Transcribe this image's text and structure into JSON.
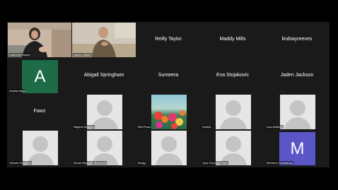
{
  "participants": {
    "p01": {
      "name": "Katherine Boyce"
    },
    "p02": {
      "name": "James Gilbert"
    },
    "p03": {
      "name": "Reilly Taylor"
    },
    "p04": {
      "name": "Maddy Mills"
    },
    "p05": {
      "name": "lindsayreeves"
    },
    "p06": {
      "name": "Amelia Nanji",
      "initial": "A",
      "avatar_color": "#1e6b48"
    },
    "p07": {
      "name": "Abigail Springham"
    },
    "p08": {
      "name": "Sumeera"
    },
    "p09": {
      "name": "Eva Stojakovic"
    },
    "p10": {
      "name": "Jaden Jackson"
    },
    "p11": {
      "name": "Fawz"
    },
    "p12": {
      "name": "Nageen Masood"
    },
    "p13": {
      "name": "Ella Proud"
    },
    "p14": {
      "name": "Amelia"
    },
    "p15": {
      "name": "Lisa McBride"
    },
    "p16": {
      "name": "Victoria Tompkins"
    },
    "p17": {
      "name": "Nicole Mazzone Bonecchi"
    },
    "p18": {
      "name": "Morgy"
    },
    "p19": {
      "name": "Xyra Chevarie-Saltz"
    },
    "p20": {
      "name": "Mehreen Chowdhury",
      "initial": "M",
      "avatar_color": "#5a56c8"
    }
  },
  "colors": {
    "background": "#000000",
    "gallery_bg": "#1a1a1a",
    "name_text": "#ffffff",
    "placeholder_bg": "#e6e6e6",
    "placeholder_figure": "#c4c4c4"
  }
}
